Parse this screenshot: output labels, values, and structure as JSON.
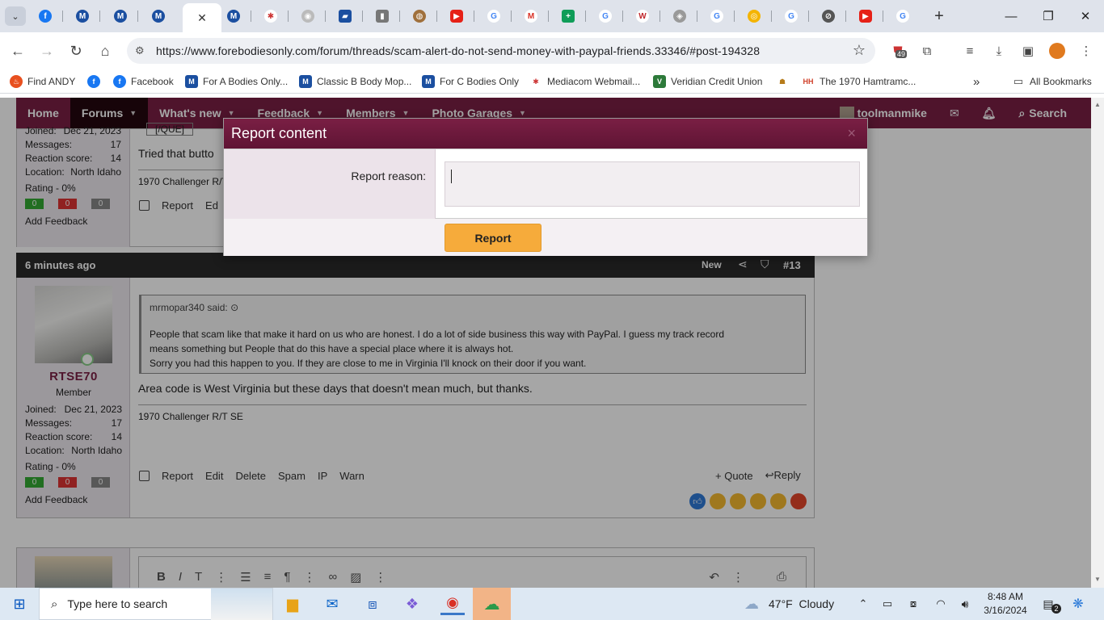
{
  "browser": {
    "url": "https://www.forebodiesonly.com/forum/threads/scam-alert-do-not-send-money-with-paypal-friends.33346/#post-194328",
    "extension_badge": "49"
  },
  "bookmarks": [
    "Find ANDY",
    "",
    "Facebook",
    "For A Bodies Only...",
    "Classic B Body Mop...",
    "For C Bodies Only",
    "Mediacom Webmail...",
    "Veridian Credit Union",
    "",
    "The 1970 Hamtramc..."
  ],
  "bookmarks_more": "»",
  "all_bookmarks": "All Bookmarks",
  "sitenav": {
    "home": "Home",
    "forums": "Forums",
    "whats_new": "What's new",
    "feedback": "Feedback",
    "members": "Members",
    "photo_garages": "Photo Garages",
    "user": "toolmanmike",
    "search": "Search"
  },
  "post1": {
    "joined_label": "Joined:",
    "joined": "Dec 21, 2023",
    "messages_label": "Messages:",
    "messages": "17",
    "reaction_label": "Reaction score:",
    "reaction": "14",
    "location_label": "Location:",
    "location": "North Idaho",
    "rating": "Rating - 0%",
    "badge_pos": "0",
    "badge_neg": "0",
    "badge_neu": "0",
    "add_feedback": "Add Feedback",
    "quote_tail": "[/QUE]",
    "text": "Tried that butto",
    "signature": "1970 Challenger R/T",
    "report": "Report",
    "edit": "Ed"
  },
  "post2": {
    "time": "6 minutes ago",
    "new_label": "New",
    "number": "#13",
    "username": "RTSE70",
    "role": "Member",
    "joined_label": "Joined:",
    "joined": "Dec 21, 2023",
    "messages_label": "Messages:",
    "messages": "17",
    "reaction_label": "Reaction score:",
    "reaction": "14",
    "location_label": "Location:",
    "location": "North Idaho",
    "rating": "Rating - 0%",
    "badge_pos": "0",
    "badge_neg": "0",
    "badge_neu": "0",
    "add_feedback": "Add Feedback",
    "quote_author": "mrmopar340 said:",
    "quote_line1": "People that scam like that make it hard on us who are honest. I do a lot of side business this way with PayPal. I guess my track record",
    "quote_line2": "means something but People that do this have a special place where it is always hot.",
    "quote_line3": "Sorry you had this happen to you. If they are close to me in Virginia I'll knock on their door if you want.",
    "text": "Area code is West Virginia but these days that doesn't mean much, but thanks.",
    "signature": "1970 Challenger R/T SE",
    "actions": [
      "Report",
      "Edit",
      "Delete",
      "Spam",
      "IP",
      "Warn"
    ],
    "quote_btn": "+ Quote",
    "reply_btn": "Reply"
  },
  "dialog": {
    "title": "Report content",
    "close": "×",
    "reason_label": "Report reason:",
    "reason_value": "",
    "submit": "Report"
  },
  "taskbar": {
    "search_placeholder": "Type here to search",
    "weather": "47°F  Cloudy",
    "time": "8:48 AM",
    "date": "3/16/2024",
    "notifications": "2"
  },
  "colors": {
    "brand": "#7a1f44",
    "button": "#f6ab3b"
  }
}
